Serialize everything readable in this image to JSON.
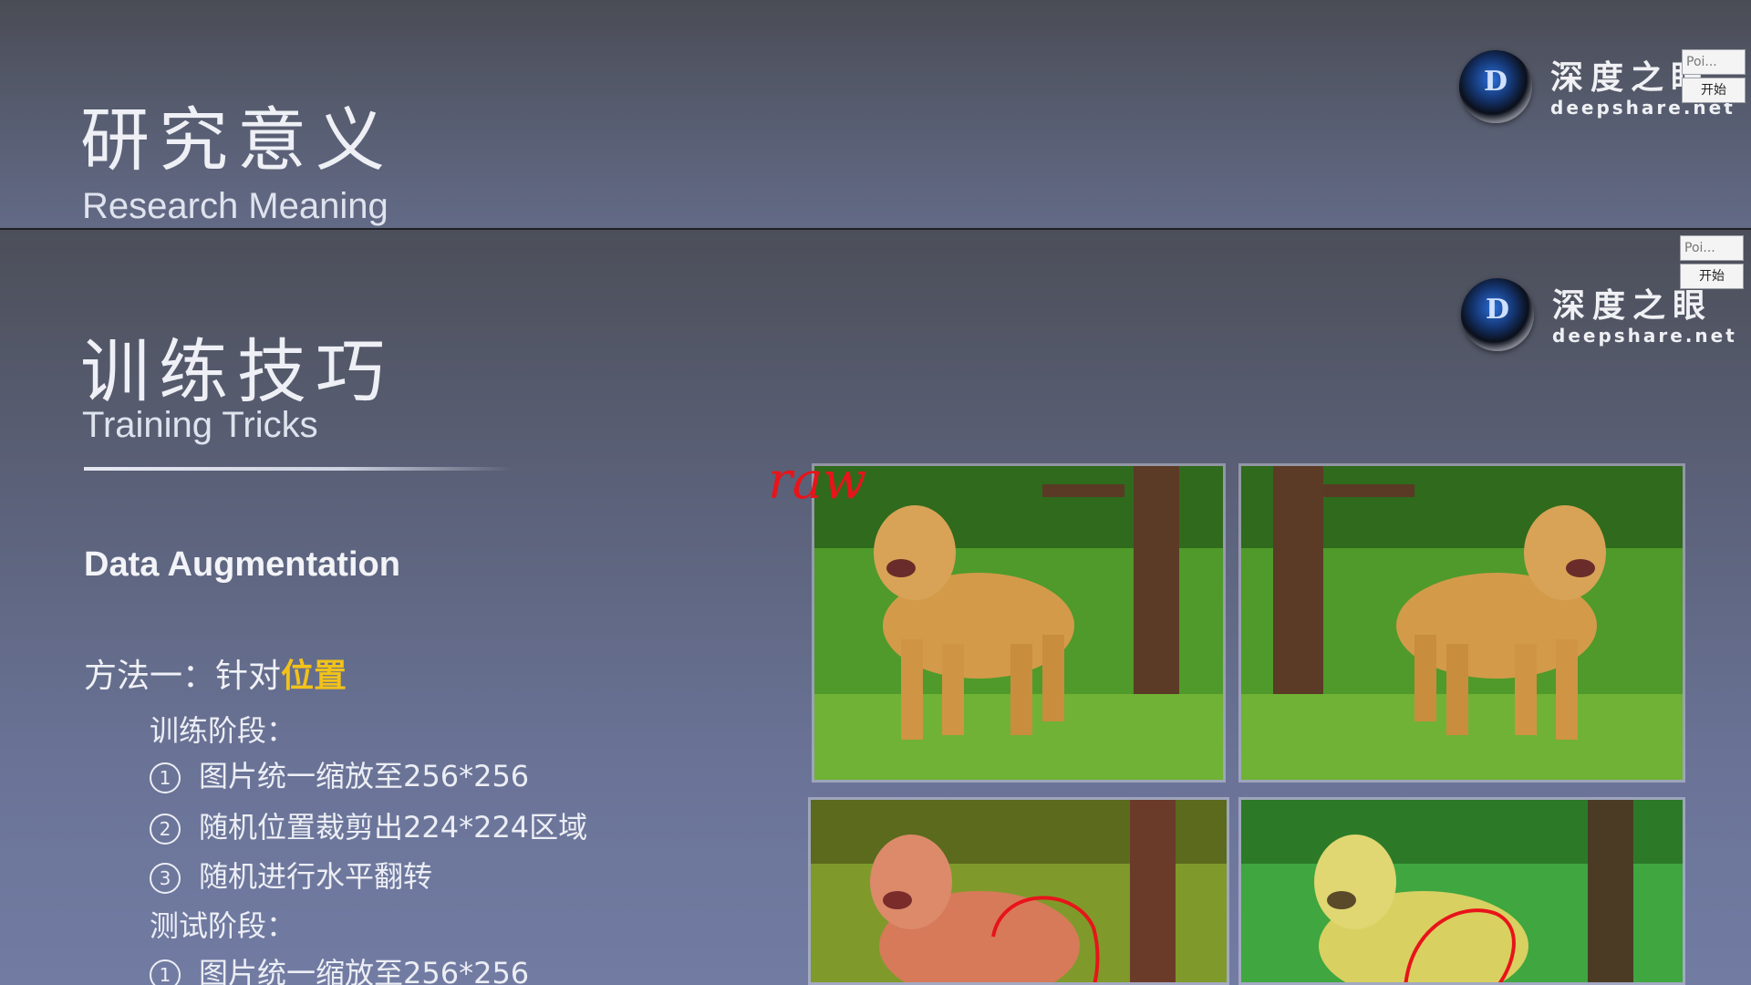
{
  "top_slide": {
    "title": "研究意义",
    "subtitle": "Research Meaning",
    "logo": {
      "name": "深度之眼",
      "domain": "deepshare.net",
      "mark": "D"
    },
    "mini_buttons": [
      "Poi...",
      "开始"
    ]
  },
  "main_slide": {
    "title": "训练技巧",
    "subtitle": "Training Tricks",
    "logo": {
      "name": "深度之眼",
      "domain": "deepshare.net",
      "mark": "D"
    },
    "mini_buttons": [
      "Poi...",
      "开始"
    ],
    "section_heading": "Data Augmentation",
    "method": {
      "prefix": "方法一：针对",
      "highlight": "位置"
    },
    "train_stage": {
      "label": "训练阶段：",
      "steps": [
        {
          "num": "1",
          "text": "图片统一缩放至256*256"
        },
        {
          "num": "2",
          "text": "随机位置裁剪出224*224区域"
        },
        {
          "num": "3",
          "text": "随机进行水平翻转"
        }
      ]
    },
    "test_stage": {
      "label": "测试阶段：",
      "steps": [
        {
          "num": "1",
          "text": "图片统一缩放至256*256"
        }
      ]
    },
    "annotation": "raw",
    "photos": [
      {
        "name": "original",
        "tint": "normal"
      },
      {
        "name": "flipped",
        "tint": "normal"
      },
      {
        "name": "color-red",
        "tint": "red"
      },
      {
        "name": "color-yellow",
        "tint": "yellow"
      }
    ],
    "colors": {
      "highlight": "#f2c21a",
      "annotation": "#e8141a",
      "grass": "#4f9a2a",
      "dog": "#d39a4a"
    }
  }
}
